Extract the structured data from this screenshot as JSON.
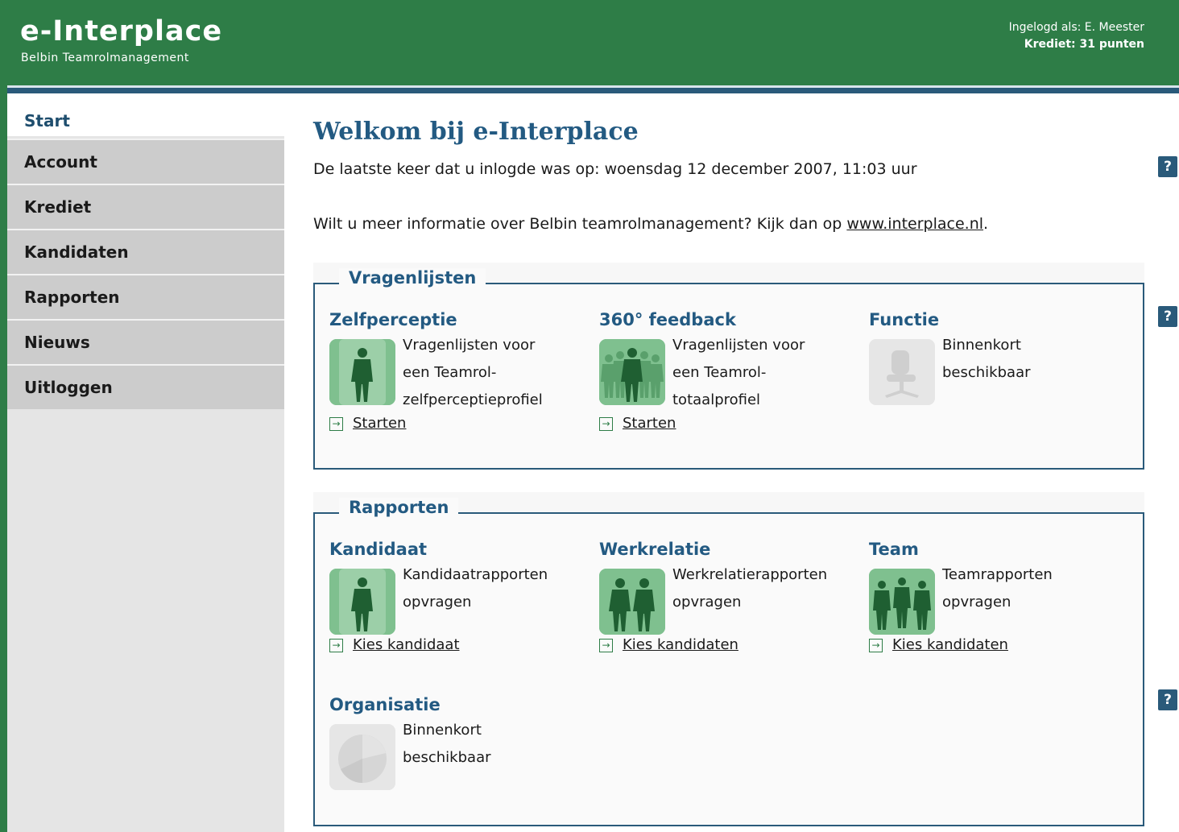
{
  "header": {
    "logo": "e-Interplace",
    "tagline": "Belbin Teamrolmanagement",
    "login_text": "Ingelogd als: E. Meester",
    "credit_text": "Krediet: 31 punten"
  },
  "sidebar": {
    "items": [
      {
        "label": "Start"
      },
      {
        "label": "Account"
      },
      {
        "label": "Krediet"
      },
      {
        "label": "Kandidaten"
      },
      {
        "label": "Rapporten"
      },
      {
        "label": "Nieuws"
      },
      {
        "label": "Uitloggen"
      }
    ]
  },
  "main": {
    "title": "Welkom bij e-Interplace",
    "last_login": "De laatste keer dat u inlogde was op: woensdag 12 december 2007, 11:03 uur",
    "info_prefix": "Wilt u meer informatie over Belbin teamrolmanagement? Kijk dan op ",
    "info_link": "www.interplace.nl",
    "info_suffix": "."
  },
  "help_label": "?",
  "questionnaires": {
    "legend": "Vragenlijsten",
    "items": [
      {
        "title": "Zelfperceptie",
        "desc": [
          "Vragenlijsten voor",
          "een Teamrol-",
          "zelfperceptieprofiel"
        ],
        "link": "Starten",
        "icon": "single-person-icon"
      },
      {
        "title": "360° feedback",
        "desc": [
          "Vragenlijsten voor",
          "een Teamrol-",
          "totaalprofiel"
        ],
        "link": "Starten",
        "icon": "group-people-icon"
      },
      {
        "title": "Functie",
        "desc": [
          "Binnenkort",
          "beschikbaar"
        ],
        "link": "",
        "icon": "office-chair-icon"
      }
    ]
  },
  "reports": {
    "legend": "Rapporten",
    "items": [
      {
        "title": "Kandidaat",
        "desc": [
          "Kandidaatrapporten",
          "opvragen"
        ],
        "link": "Kies kandidaat",
        "icon": "single-person-icon"
      },
      {
        "title": "Werkrelatie",
        "desc": [
          "Werkrelatierapporten",
          "opvragen"
        ],
        "link": "Kies kandidaten",
        "icon": "two-people-icon"
      },
      {
        "title": "Team",
        "desc": [
          "Teamrapporten",
          "opvragen"
        ],
        "link": "Kies kandidaten",
        "icon": "team-people-icon"
      },
      {
        "title": "Organisatie",
        "desc": [
          "Binnenkort",
          "beschikbaar"
        ],
        "link": "",
        "icon": "pie-chart-icon"
      }
    ]
  },
  "colors": {
    "brand_green": "#2e7d47",
    "accent_blue": "#235a82",
    "icon_green": "#7fc08f"
  }
}
